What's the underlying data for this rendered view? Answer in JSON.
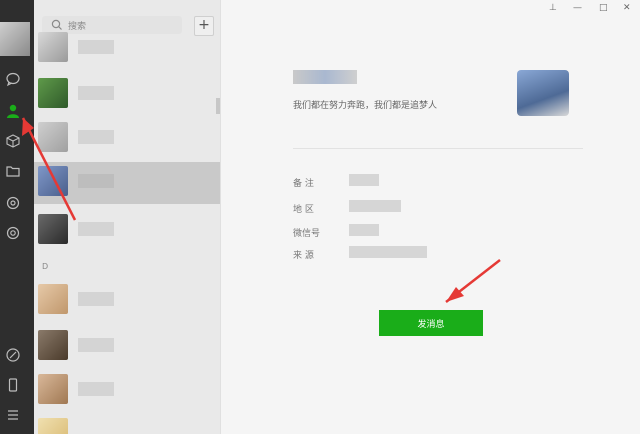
{
  "search": {
    "placeholder": "搜索"
  },
  "list": {
    "add_label": "+",
    "section_letter": "D"
  },
  "profile": {
    "signature": "我们都在努力奔跑，我们都是追梦人",
    "fields": [
      {
        "label": "备 注"
      },
      {
        "label": "地 区"
      },
      {
        "label": "微信号"
      },
      {
        "label": "来 源"
      }
    ],
    "send_button": "发消息"
  },
  "colors": {
    "accent_green": "#1aad19",
    "arrow_red": "#e53935",
    "nav_bg": "#2e2e2e"
  }
}
